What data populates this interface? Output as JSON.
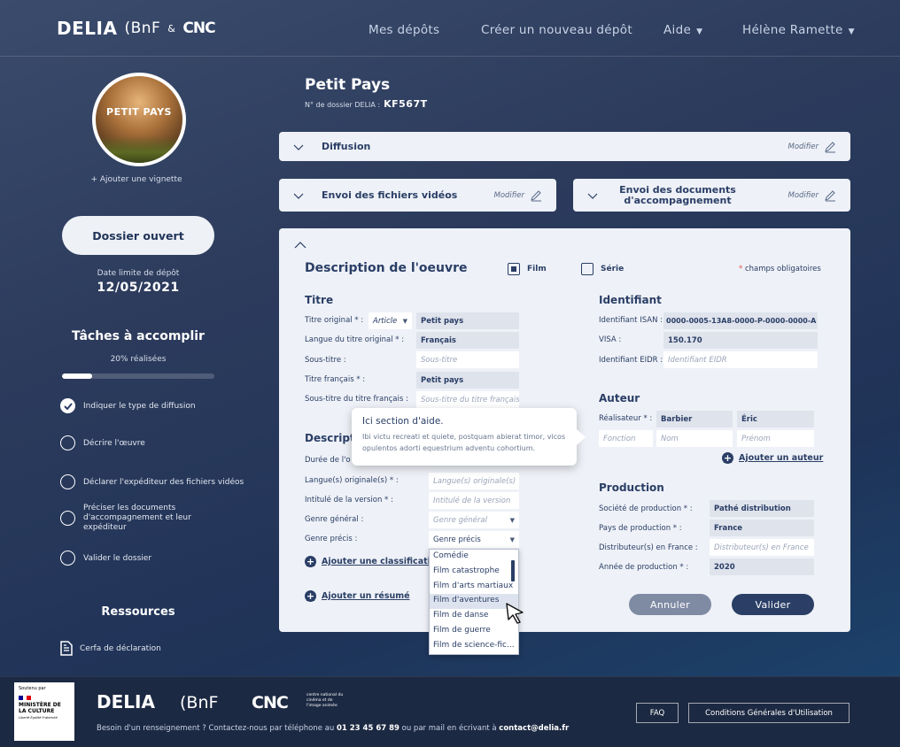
{
  "header": {
    "logo": "DELIA",
    "logo_bnf": "(BnF",
    "logo_amp": "&",
    "logo_cnc": "CNC",
    "nav": {
      "my_deposits": "Mes dépôts",
      "new_deposit": "Créer un nouveau dépôt",
      "help": "Aide",
      "user": "Hélène Ramette"
    }
  },
  "sidebar": {
    "thumbnail_title": "PETIT PAYS",
    "add_thumbnail": "+ Ajouter une vignette",
    "status": "Dossier ouvert",
    "deadline_label": "Date limite de dépôt",
    "deadline": "12/05/2021",
    "tasks_title": "Tâches à accomplir",
    "progress_label": "20% réalisées",
    "progress_value": 0.2,
    "tasks": [
      {
        "label": "Indiquer le type de diffusion",
        "done": true
      },
      {
        "label": "Décrire l'œuvre",
        "done": false
      },
      {
        "label": "Déclarer l'expéditeur des fichiers vidéos",
        "done": false
      },
      {
        "label": "Préciser les documents d'accompagnement et leur expéditeur",
        "done": false
      },
      {
        "label": "Valider le dossier",
        "done": false
      }
    ],
    "resources_title": "Ressources",
    "resource_link": "Cerfa de déclaration"
  },
  "main": {
    "title": "Petit Pays",
    "file_number_label": "N° de dossier DELIA :",
    "file_number": "KF567T",
    "sections": {
      "diffusion": "Diffusion",
      "videos": "Envoi des fichiers vidéos",
      "documents": "Envoi des documents d'accompagnement",
      "modify": "Modifier"
    },
    "description": {
      "title": "Description de l'oeuvre",
      "film": "Film",
      "serie": "Série",
      "required_note": "champs obligatoires",
      "required_star": "*"
    },
    "titre": {
      "heading": "Titre",
      "original_label": "Titre original * :",
      "article": "Article",
      "original_value": "Petit pays",
      "lang_label": "Langue du titre original * :",
      "lang_value": "Français",
      "subtitle_label": "Sous-titre :",
      "subtitle_placeholder": "Sous-titre",
      "fr_label": "Titre français * :",
      "fr_value": "Petit pays",
      "fr_sub_label": "Sous-titre du titre français :",
      "fr_sub_placeholder": "Sous-titre du titre français"
    },
    "desc": {
      "heading": "Descript",
      "duration_label": "Durée de l'o",
      "lang_orig_label": "Langue(s) originale(s) * :",
      "lang_orig_placeholder": "Langue(s) originale(s)",
      "version_label": "Intitulé de la version * :",
      "version_placeholder": "Intitulé de la version",
      "genre_label": "Genre général :",
      "genre_placeholder": "Genre général",
      "genre_precise_label": "Genre précis :",
      "genre_precise_value": "Genre précis",
      "add_classification": "Ajouter une classification",
      "add_summary": "Ajouter un résumé"
    },
    "dropdown_options": [
      "Comédie",
      "Film catastrophe",
      "Film d'arts martiaux",
      "Film d'aventures",
      "Film de danse",
      "Film de guerre",
      "Film de science-fic..."
    ],
    "dropdown_highlight_index": 3,
    "identifiant": {
      "heading": "Identifiant",
      "isan_label": "Identifiant ISAN :",
      "isan_value": "0000-0005-13A8-0000-P-0000-0000-A",
      "visa_label": "VISA :",
      "visa_value": "150.170",
      "eidr_label": "Identifiant EIDR :",
      "eidr_placeholder": "Identifiant EIDR"
    },
    "auteur": {
      "heading": "Auteur",
      "director_label": "Réalisateur * :",
      "director_last": "Barbier",
      "director_first": "Éric",
      "role_placeholder": "Fonction",
      "name_placeholder": "Nom",
      "firstname_placeholder": "Prénom",
      "add_author": "Ajouter un auteur"
    },
    "production": {
      "heading": "Production",
      "company_label": "Société de production * :",
      "company_value": "Pathé distribution",
      "country_label": "Pays de production * :",
      "country_value": "France",
      "distrib_label": "Distributeur(s) en France :",
      "distrib_placeholder": "Distributeur(s) en France",
      "year_label": "Année de production * :",
      "year_value": "2020"
    },
    "buttons": {
      "cancel": "Annuler",
      "validate": "Valider"
    },
    "tooltip": {
      "title": "Ici section d'aide.",
      "body": "Ibi victu recreati et quiete, postquam abierat timor, vicos opulentos adorti equestrium adventu cohortium."
    }
  },
  "footer": {
    "gov_sup": "Soutenu par",
    "gov_ministry": "MINISTÈRE DE LA CULTURE",
    "gov_motto": "Liberté Égalité Fraternité",
    "logo": "DELIA",
    "bnf": "(BnF",
    "cnc": "CNC",
    "cnc_sub": "centre national du cinéma et de l'image animée",
    "contact_prefix": "Besoin d'un renseignement ? Contactez-nous par téléphone au",
    "phone": "01 23 45 67 89",
    "contact_mid": "ou par mail en écrivant à",
    "email": "contact@delia.fr",
    "faq": "FAQ",
    "cgu": "Conditions Générales d'Utilisation"
  }
}
